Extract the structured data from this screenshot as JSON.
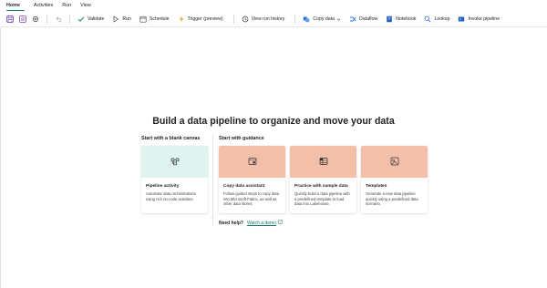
{
  "menu": {
    "tabs": [
      {
        "label": "Home",
        "active": true
      },
      {
        "label": "Activities",
        "active": false
      },
      {
        "label": "Run",
        "active": false
      },
      {
        "label": "View",
        "active": false
      }
    ]
  },
  "toolbar": {
    "validate": "Validate",
    "run": "Run",
    "schedule": "Schedule",
    "trigger": "Trigger (preview)",
    "view_run_history": "View run history",
    "copy_data": "Copy data",
    "dataflow": "Dataflow",
    "notebook": "Notebook",
    "lookup": "Lookup",
    "invoke_pipeline": "Invoke pipeline"
  },
  "main": {
    "headline": "Build a data pipeline to organize and move your data",
    "blank_section": "Start with a blank canvas",
    "guidance_section": "Start with guidance",
    "cards": [
      {
        "title": "Pipeline activity",
        "desc": "Automate data orchestrations using rich no-code activities."
      },
      {
        "title": "Copy data assistant",
        "desc": "Follow guided steps to copy data into Microsoft Fabric, as well as other data stores."
      },
      {
        "title": "Practice with sample data",
        "desc": "Quickly build a data pipeline with a predefined template to load data into Lakehouse."
      },
      {
        "title": "Templates",
        "desc": "Generate a new data pipeline quickly using a predefined data scenario."
      }
    ],
    "help_question": "Need help?",
    "help_link": "Watch a demo"
  },
  "colors": {
    "accent": "#117865",
    "teal_banner": "#dff4ef",
    "peach_banner": "#f4bfa8"
  }
}
